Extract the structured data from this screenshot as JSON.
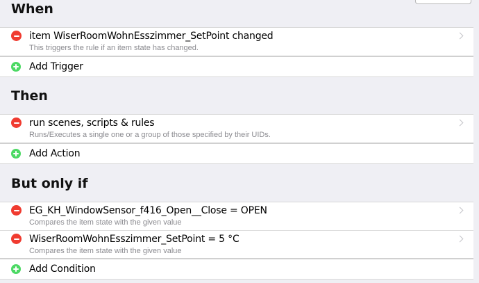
{
  "when": {
    "heading": "When",
    "items": [
      {
        "title": "item WiserRoomWohnEsszimmer_SetPoint changed",
        "description": "This triggers the rule if an item state has changed."
      }
    ],
    "add_label": "Add Trigger"
  },
  "then": {
    "heading": "Then",
    "items": [
      {
        "title": "run scenes, scripts & rules",
        "description": "Runs/Executes a single one or a group of those specified by their UIDs."
      }
    ],
    "add_label": "Add Action"
  },
  "only_if": {
    "heading": "But only if",
    "items": [
      {
        "title": "EG_KH_WindowSensor_f416_Open__Close = OPEN",
        "description": "Compares the item state with the given value"
      },
      {
        "title": "WiserRoomWohnEsszimmer_SetPoint = 5 °C",
        "description": "Compares the item state with the given value"
      }
    ],
    "add_label": "Add Condition"
  },
  "colors": {
    "remove": "#f03b30",
    "add": "#4cd964",
    "background": "#efeff4"
  },
  "icons": {
    "remove": "minus-circle-icon",
    "add": "plus-circle-icon",
    "chevron": "chevron-right-icon"
  }
}
